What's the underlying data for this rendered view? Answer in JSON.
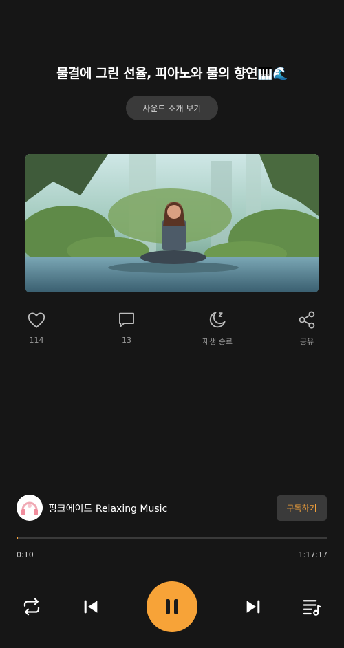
{
  "track": {
    "title": "물결에 그린 선율, 피아노와 물의 향연",
    "title_emoji": "🎹🌊",
    "intro_button_label": "사운드 소개 보기"
  },
  "actions": {
    "like_count": "114",
    "comment_count": "13",
    "sleep_timer_label": "재생 종료",
    "share_label": "공유"
  },
  "channel": {
    "name": "핑크에이드 Relaxing Music",
    "subscribe_label": "구독하기"
  },
  "player": {
    "current_time": "0:10",
    "total_time": "1:17:17",
    "progress_fraction": 0.0022
  },
  "colors": {
    "accent": "#f7a338",
    "background": "#161616",
    "button_bg": "#3a3a3a"
  },
  "icons": {
    "like": "heart-icon",
    "comment": "chat-bubble-icon",
    "sleep": "moon-zz-icon",
    "share": "share-icon",
    "repeat": "repeat-icon",
    "previous": "skip-previous-icon",
    "pause": "pause-icon",
    "next": "skip-next-icon",
    "playlist": "playlist-icon"
  }
}
